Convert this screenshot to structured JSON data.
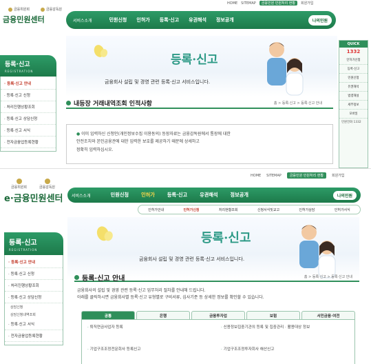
{
  "top": {
    "toplinks": [
      "HOME",
      "SITEMAP",
      "금융민원 민원처리 현황",
      "회원가입"
    ],
    "logo": {
      "emblems": [
        "금융위원회",
        "금융감독원"
      ],
      "name": "금융민원센터"
    },
    "nav": {
      "service": "서비스소개",
      "items": [
        "민원신청",
        "인허가",
        "등록·신고",
        "유권해석",
        "정보공개"
      ],
      "mypage": "나의민원"
    },
    "quick": {
      "title": "QUICK",
      "number": "1332",
      "items": [
        "인허가신청",
        "등록·신고",
        "민원신청",
        "유권해석",
        "법령해설",
        "세부정보",
        "모바일"
      ],
      "tel": "민원전화 1332"
    },
    "banner": {
      "title": "등록·신고",
      "subtitle": "금융회사 설립 및 경영 관련 등록·신고 서비스입니다."
    },
    "sidebar": {
      "title": "등록·신고",
      "subtitle": "REGISTRATION",
      "items": [
        "등록·신고 안내",
        "등록·신고 신청",
        "처리진행상황조회",
        "등록·신고 상담신청",
        "등록·신고 서식",
        "전자금융업등록현황"
      ]
    },
    "page_title": "내등장 거래내역조회 인적사항",
    "breadcrumb": "홈 > 등록·신고 > 등록·신고 안내",
    "notice": [
      "이미 입력하신 신청인(개인정보수집 이용동의) 등장자료는 금융감독원에서 통장에 대한",
      "안전조치와 본인금융관에 대한 입력한 보호를 제공하기 때문에 상세하고",
      "정확히 입력하십시오."
    ]
  },
  "bottom": {
    "toplinks": [
      "HOME",
      "SITEMAP",
      "금융민원 민원처리 현황",
      "회원가입"
    ],
    "logo": {
      "emblems": [
        "금융위원회",
        "금융감독원"
      ],
      "name": "e·금융민원센터"
    },
    "nav": {
      "service": "서비스소개",
      "items": [
        "민원신청",
        "인허가",
        "등록·신고",
        "유권해석",
        "정보공개"
      ],
      "mypage": "나의민원"
    },
    "subnav": [
      "인허가안내",
      "인허가신청",
      "처리현황조회",
      "신청서식및교고",
      "인허가상담",
      "인허가서식"
    ],
    "banner": {
      "title": "등록·신고",
      "subtitle": "금융회사 설립 및 경영 관련 등록·신고 서비스입니다."
    },
    "sidebar": {
      "title": "등록·신고",
      "subtitle": "REGISTRATION",
      "items": [
        "등록·신고 안내",
        "등록·신고 신청",
        "처리진행상황조회",
        "등록·신고 상담신청"
      ],
      "subitems": [
        "상담신청",
        "상담신청내역조회"
      ],
      "items2": [
        "등록·신고 서식",
        "전자금융업등록현황"
      ]
    },
    "page_title": "등록·신고 안내",
    "breadcrumb": "홈 > 등록·신고 > 등록·신고 안내",
    "intro": [
      "금융회사의 설립 및 경영 관련 등록·신고 업무처리 절차를 안내해 드립니다.",
      "아래를 클릭하시면 금융회사별 등록·신고 유형별로 구비서류, 심사기준 등 상세한 정보를 확인할 수 있습니다."
    ],
    "tabs": [
      "공통",
      "은행",
      "금융투자업",
      "보험",
      "서민금융·여전"
    ],
    "grid": [
      "퇴직연금사업자 등록",
      "신용정보집중기관의 등록 및 집중관리 · 활용대상 정보",
      "기업구조조정전문회사 등록신고",
      "기업구조조정투자회사 해산신고"
    ]
  }
}
